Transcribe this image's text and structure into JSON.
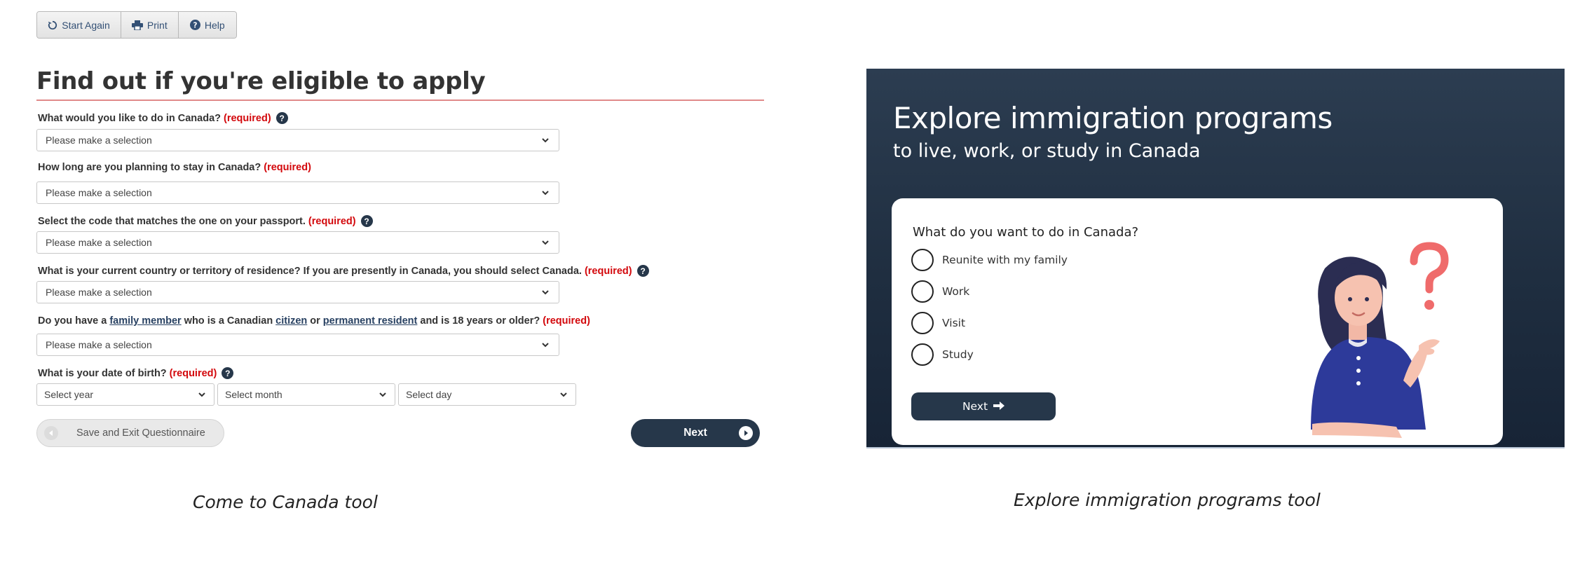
{
  "toolbar": {
    "start_again": "Start Again",
    "print": "Print",
    "help": "Help"
  },
  "form": {
    "title": "Find out if you're eligible to apply",
    "required_label": "(required)",
    "placeholder": "Please make a selection",
    "questions": [
      {
        "text": "What would you like to do in Canada?"
      },
      {
        "text": "How long are you planning to stay in Canada?"
      },
      {
        "text": "Select the code that matches the one on your passport."
      },
      {
        "text": "What is your current country or territory of residence? If you are presently in Canada, you should select Canada."
      },
      {
        "pre": "Do you have a",
        "link1": "family member",
        "mid1": "who is a Canadian",
        "link2": "citizen",
        "mid2": "or",
        "link3": "permanent resident",
        "post": "and is 18 years or older?"
      },
      {
        "text": "What is your date of birth?"
      }
    ],
    "dob": {
      "year": "Select year",
      "month": "Select month",
      "day": "Select day"
    },
    "save_exit": "Save and Exit Questionnaire",
    "next": "Next"
  },
  "captions": {
    "left": "Come to Canada tool",
    "right": "Explore immigration programs tool"
  },
  "explore": {
    "title": "Explore immigration programs",
    "subtitle": "to live, work, or study in Canada",
    "question": "What do you want to do in Canada?",
    "options": [
      "Reunite with my family",
      "Work",
      "Visit",
      "Study"
    ],
    "next": "Next"
  },
  "colors": {
    "accent": "#26374a",
    "required": "#d3080c",
    "link": "#284162",
    "title_rule": "#e08a8a"
  }
}
